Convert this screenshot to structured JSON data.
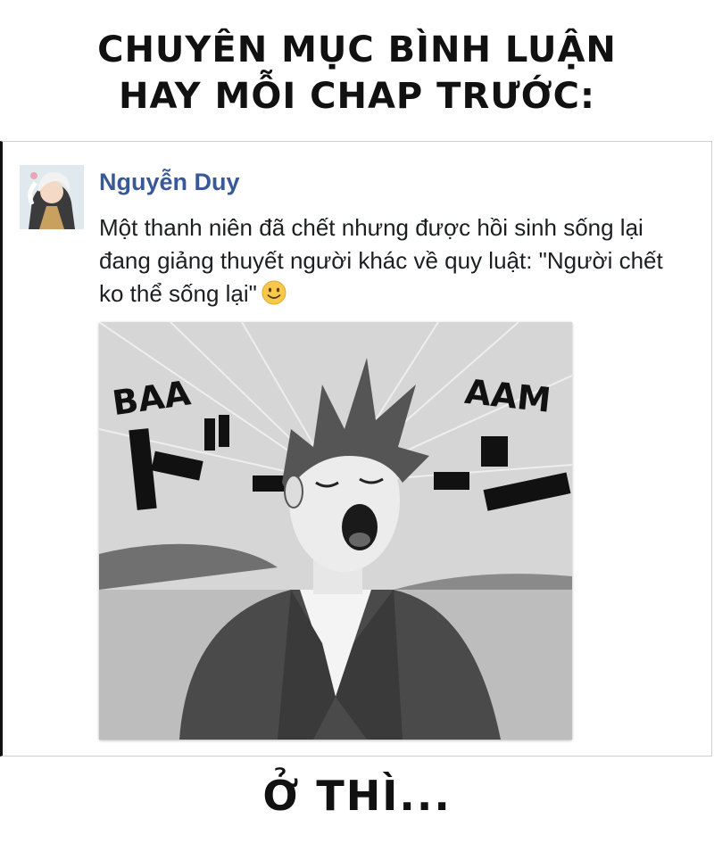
{
  "header": {
    "line1": "CHUYÊN MỤC BÌNH LUẬN",
    "line2": "HAY MỖI CHAP TRƯỚC:"
  },
  "comment": {
    "author": "Nguyễn Duy",
    "text": "Một thanh niên đã chết nhưng được hồi sinh sống lại đang giảng thuyết người khác về quy luật: \"Người chết ko thể sống lại\"",
    "emoji": "slightly-smiling-face-icon"
  },
  "image": {
    "sfx_left": "BAA",
    "sfx_right": "AAM"
  },
  "footer": {
    "text": "Ở THÌ..."
  },
  "colors": {
    "author": "#385898",
    "text": "#1c1e21",
    "emoji": "#f7c84a"
  }
}
